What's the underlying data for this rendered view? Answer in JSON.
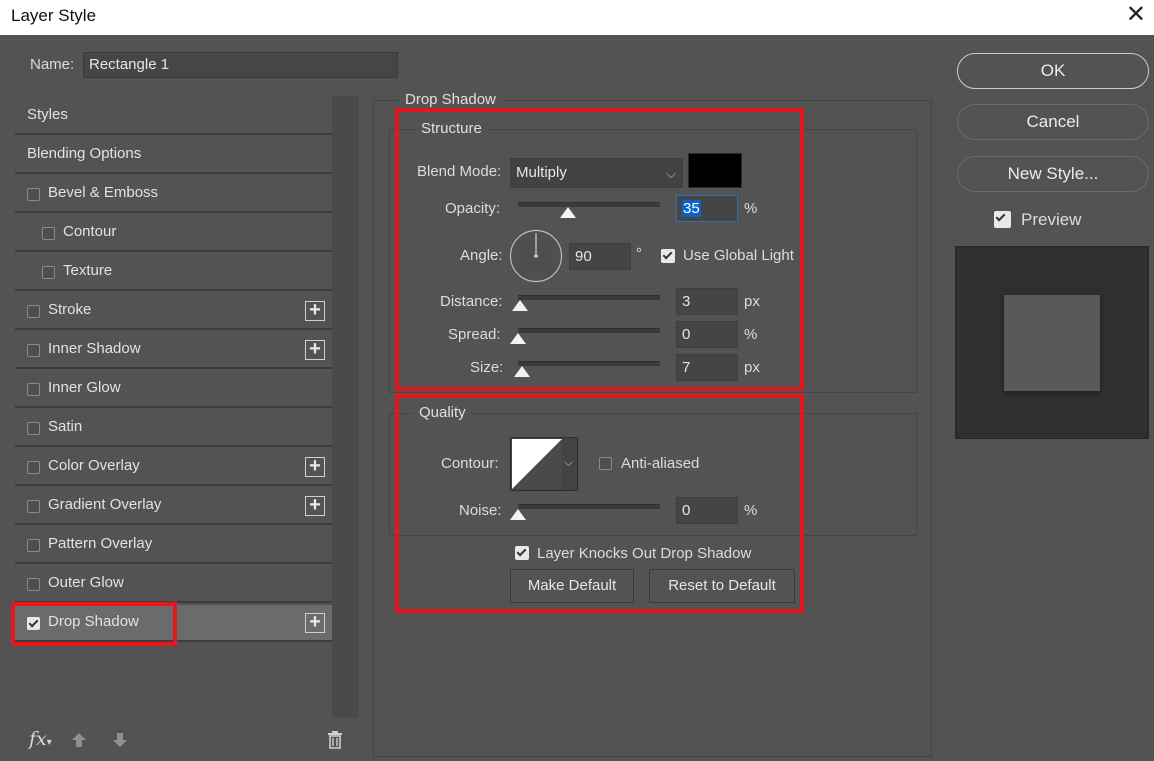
{
  "window": {
    "title": "Layer Style",
    "close_icon": "close-icon"
  },
  "name_field": {
    "label": "Name:",
    "value": "Rectangle 1"
  },
  "styles_list": {
    "items": [
      {
        "label": "Styles",
        "checkbox": false,
        "checked": false,
        "plus": false,
        "indent": 0
      },
      {
        "label": "Blending Options",
        "checkbox": false,
        "checked": false,
        "plus": false,
        "indent": 0
      },
      {
        "label": "Bevel & Emboss",
        "checkbox": true,
        "checked": false,
        "plus": false,
        "indent": 0
      },
      {
        "label": "Contour",
        "checkbox": true,
        "checked": false,
        "plus": false,
        "indent": 1
      },
      {
        "label": "Texture",
        "checkbox": true,
        "checked": false,
        "plus": false,
        "indent": 1
      },
      {
        "label": "Stroke",
        "checkbox": true,
        "checked": false,
        "plus": true,
        "indent": 0
      },
      {
        "label": "Inner Shadow",
        "checkbox": true,
        "checked": false,
        "plus": true,
        "indent": 0
      },
      {
        "label": "Inner Glow",
        "checkbox": true,
        "checked": false,
        "plus": false,
        "indent": 0
      },
      {
        "label": "Satin",
        "checkbox": true,
        "checked": false,
        "plus": false,
        "indent": 0
      },
      {
        "label": "Color Overlay",
        "checkbox": true,
        "checked": false,
        "plus": true,
        "indent": 0
      },
      {
        "label": "Gradient Overlay",
        "checkbox": true,
        "checked": false,
        "plus": true,
        "indent": 0
      },
      {
        "label": "Pattern Overlay",
        "checkbox": true,
        "checked": false,
        "plus": false,
        "indent": 0
      },
      {
        "label": "Outer Glow",
        "checkbox": true,
        "checked": false,
        "plus": false,
        "indent": 0
      },
      {
        "label": "Drop Shadow",
        "checkbox": true,
        "checked": true,
        "plus": true,
        "indent": 0,
        "selected": true
      }
    ]
  },
  "bottom_toolbar": {
    "fx_label": "fx"
  },
  "drop_shadow": {
    "section_title": "Drop Shadow",
    "structure": {
      "title": "Structure",
      "blend_mode": {
        "label": "Blend Mode:",
        "value": "Multiply",
        "color": "#000000"
      },
      "opacity": {
        "label": "Opacity:",
        "value": "35",
        "unit": "%",
        "level": 35
      },
      "angle": {
        "label": "Angle:",
        "value": "90",
        "unit": "°",
        "global_light_label": "Use Global Light",
        "global_light": true
      },
      "distance": {
        "label": "Distance:",
        "value": "3",
        "unit": "px",
        "level": 3
      },
      "spread": {
        "label": "Spread:",
        "value": "0",
        "unit": "%",
        "level": 0
      },
      "size": {
        "label": "Size:",
        "value": "7",
        "unit": "px",
        "level": 7
      }
    },
    "quality": {
      "title": "Quality",
      "contour": {
        "label": "Contour:",
        "anti_aliased_label": "Anti-aliased",
        "anti_aliased": false
      },
      "noise": {
        "label": "Noise:",
        "value": "0",
        "unit": "%",
        "level": 0
      },
      "knockout_label": "Layer Knocks Out Drop Shadow",
      "knockout": true,
      "make_default_label": "Make Default",
      "reset_default_label": "Reset to Default"
    }
  },
  "right_panel": {
    "ok_label": "OK",
    "cancel_label": "Cancel",
    "new_style_label": "New Style...",
    "preview_label": "Preview",
    "preview_checked": true
  },
  "colors": {
    "highlight": "#e3171e",
    "panel": "#535353",
    "selection": "#0a64c8"
  }
}
